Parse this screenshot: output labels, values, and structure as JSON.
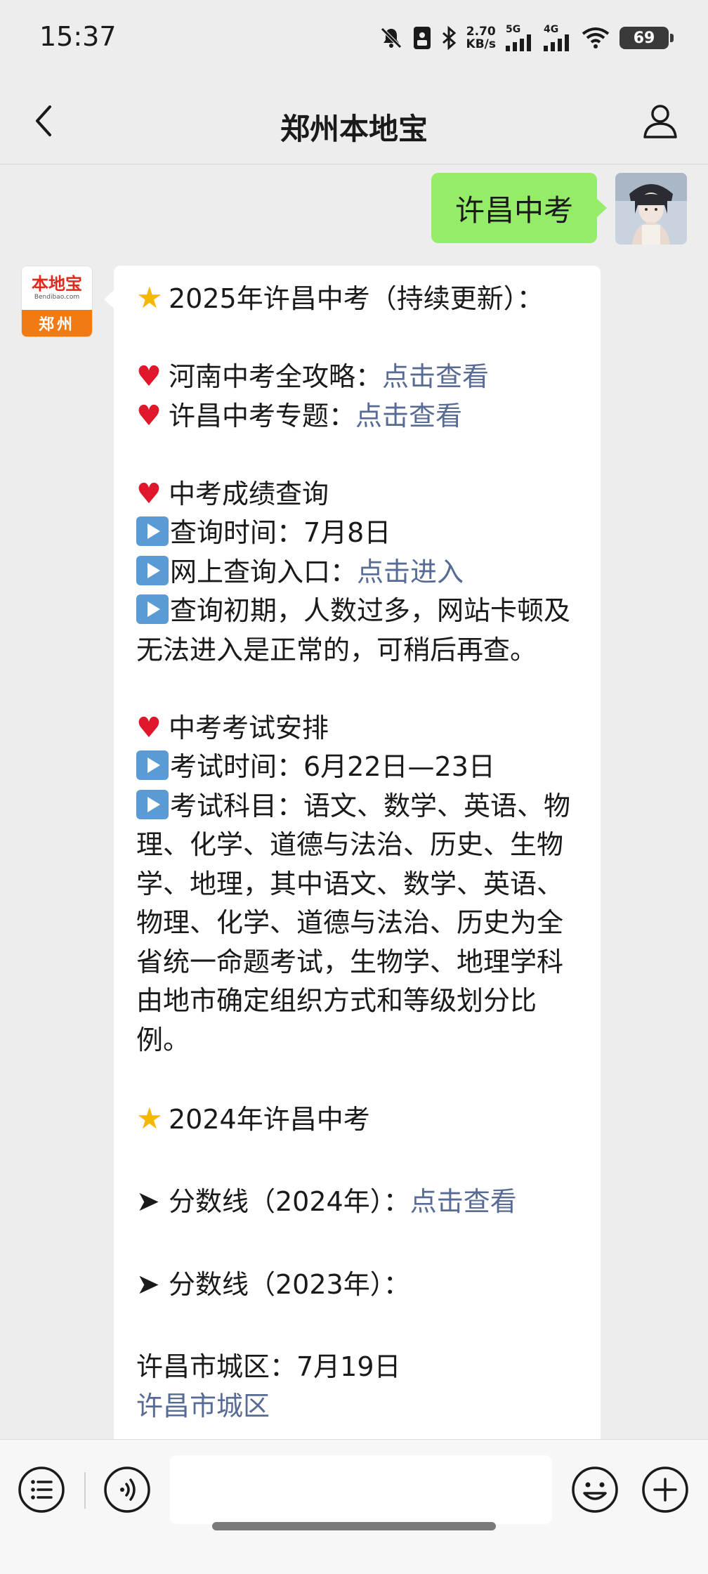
{
  "status_bar": {
    "time": "15:37",
    "net_speed_value": "2.70",
    "net_speed_unit": "KB/s",
    "signal_1": "5G",
    "signal_2": "4G",
    "battery": "69",
    "icons": [
      "mute-bell-icon",
      "sim-card-icon",
      "bluetooth-icon",
      "signal-icon",
      "wifi-icon",
      "battery-icon"
    ]
  },
  "nav": {
    "title": "郑州本地宝",
    "back_icon": "chevron-left-icon",
    "profile_icon": "person-icon"
  },
  "my_message": {
    "text": "许昌中考"
  },
  "sender_avatar": {
    "brand": "本地宝",
    "domain": "Bendibao.com",
    "city": "郑州"
  },
  "reply": {
    "title_prefix": "2025年许昌中考（持续更新）：",
    "guide_label": "河南中考全攻略：",
    "guide_link": "点击查看",
    "topic_label": "许昌中考专题：",
    "topic_link": "点击查看",
    "score_heading": "中考成绩查询",
    "query_time": "查询时间：7月8日",
    "query_entry_label": "网上查询入口：",
    "query_entry_link": "点击进入",
    "query_note": "查询初期，人数过多，网站卡顿及无法进入是正常的，可稍后再查。",
    "exam_heading": "中考考试安排",
    "exam_time": "考试时间：6月22日—23日",
    "exam_subjects": "考试科目：语文、数学、英语、物理、化学、道德与法治、历史、生物学、地理，其中语文、数学、英语、物理、化学、道德与法治、历史为全省统一命题考试，生物学、地理学科由地市确定组织方式和等级划分比例。",
    "section_2024": "2024年许昌中考",
    "score_2024_label": "分数线（2024年）：",
    "score_2024_link": "点击查看",
    "score_2023_label": "分数线（2023年）：",
    "urban_date": "许昌市城区：7月19日",
    "urban_link": "许昌市城区"
  },
  "input_bar": {
    "menu_icon": "list-menu-icon",
    "voice_icon": "voice-icon",
    "emoji_icon": "smiley-icon",
    "plus_icon": "plus-icon",
    "input_value": ""
  }
}
